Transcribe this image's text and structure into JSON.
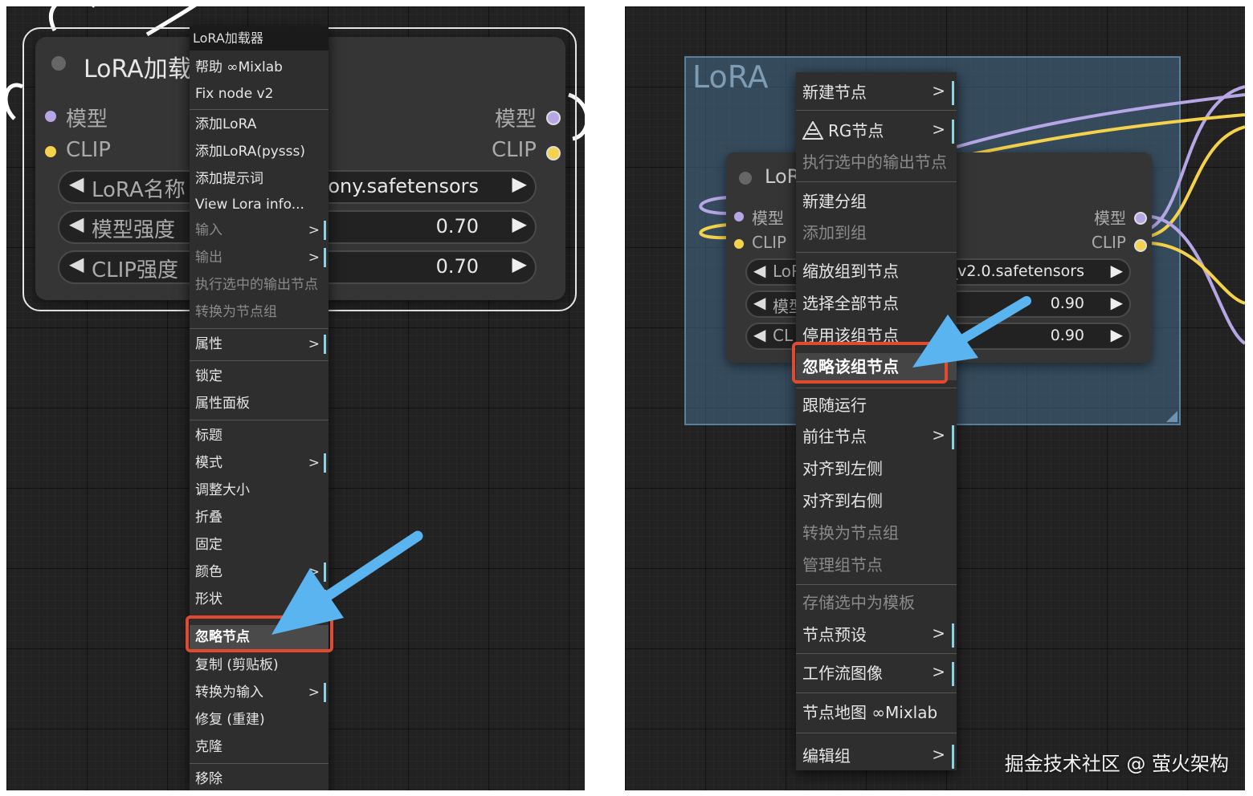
{
  "left": {
    "node": {
      "title": "LoRA加载",
      "inputs": [
        "模型",
        "CLIP"
      ],
      "outputs": [
        "模型",
        "CLIP"
      ],
      "widgets": [
        {
          "label": "LoRA名称",
          "value": "oony.safetensors"
        },
        {
          "label": "模型强度",
          "value": "0.70"
        },
        {
          "label": "CLIP强度",
          "value": "0.70"
        }
      ]
    },
    "menu": {
      "header": "LoRA加载器",
      "items": [
        {
          "label": "帮助 ∞Mixlab",
          "disabled": false,
          "submenu": false
        },
        {
          "label": "Fix node v2",
          "disabled": false,
          "submenu": false
        },
        {
          "label": "添加LoRA",
          "disabled": false,
          "submenu": false
        },
        {
          "label": "添加LoRA(pysss)",
          "disabled": false,
          "submenu": false
        },
        {
          "label": "添加提示词",
          "disabled": false,
          "submenu": false
        },
        {
          "label": "View Lora info...",
          "disabled": false,
          "submenu": false
        },
        {
          "label": "输入",
          "disabled": true,
          "submenu": true
        },
        {
          "label": "输出",
          "disabled": true,
          "submenu": true
        },
        {
          "label": "执行选中的输出节点",
          "disabled": true,
          "submenu": false
        },
        {
          "label": "转换为节点组",
          "disabled": true,
          "submenu": false
        },
        {
          "label": "属性",
          "disabled": false,
          "submenu": true
        },
        {
          "label": "锁定",
          "disabled": false,
          "submenu": false
        },
        {
          "label": "属性面板",
          "disabled": false,
          "submenu": false
        },
        {
          "label": "标题",
          "disabled": false,
          "submenu": false
        },
        {
          "label": "模式",
          "disabled": false,
          "submenu": true
        },
        {
          "label": "调整大小",
          "disabled": false,
          "submenu": false
        },
        {
          "label": "折叠",
          "disabled": false,
          "submenu": false
        },
        {
          "label": "固定",
          "disabled": false,
          "submenu": false
        },
        {
          "label": "颜色",
          "disabled": false,
          "submenu": true
        },
        {
          "label": "形状",
          "disabled": false,
          "submenu": true
        },
        {
          "label": "忽略节点",
          "disabled": false,
          "submenu": false,
          "highlighted": true
        },
        {
          "label": "复制 (剪贴板)",
          "disabled": false,
          "submenu": false
        },
        {
          "label": "转换为输入",
          "disabled": false,
          "submenu": true
        },
        {
          "label": "修复 (重建)",
          "disabled": false,
          "submenu": false
        },
        {
          "label": "克隆",
          "disabled": false,
          "submenu": false
        },
        {
          "label": "移除",
          "disabled": false,
          "submenu": false
        }
      ]
    }
  },
  "right": {
    "group": {
      "title": "LoRA"
    },
    "node": {
      "title": "LoR",
      "inputs": [
        "模型",
        "CLIP"
      ],
      "outputs": [
        "模型",
        "CLIP"
      ],
      "widgets": [
        {
          "label": "LoR",
          "value": "_v2.0.safetensors"
        },
        {
          "label": "模型",
          "value": "0.90"
        },
        {
          "label": "CL",
          "value": "0.90"
        }
      ]
    },
    "menu": {
      "items": [
        {
          "label": "新建节点",
          "disabled": false,
          "submenu": true
        },
        {
          "label": "RG节点",
          "disabled": false,
          "submenu": true,
          "icon": "rg-logo-icon"
        },
        {
          "label": "执行选中的输出节点",
          "disabled": true,
          "submenu": false
        },
        {
          "label": "新建分组",
          "disabled": false,
          "submenu": false
        },
        {
          "label": "添加到组",
          "disabled": true,
          "submenu": false
        },
        {
          "label": "缩放组到节点",
          "disabled": false,
          "submenu": false
        },
        {
          "label": "选择全部节点",
          "disabled": false,
          "submenu": false
        },
        {
          "label": "停用该组节点",
          "disabled": false,
          "submenu": false
        },
        {
          "label": "忽略该组节点",
          "disabled": false,
          "submenu": false,
          "highlighted": true
        },
        {
          "label": "跟随运行",
          "disabled": false,
          "submenu": false
        },
        {
          "label": "前往节点",
          "disabled": false,
          "submenu": true
        },
        {
          "label": "对齐到左侧",
          "disabled": false,
          "submenu": false
        },
        {
          "label": "对齐到右侧",
          "disabled": false,
          "submenu": false
        },
        {
          "label": "转换为节点组",
          "disabled": true,
          "submenu": false
        },
        {
          "label": "管理组节点",
          "disabled": true,
          "submenu": false
        },
        {
          "label": "存储选中为模板",
          "disabled": true,
          "submenu": false
        },
        {
          "label": "节点预设",
          "disabled": false,
          "submenu": true
        },
        {
          "label": "工作流图像",
          "disabled": false,
          "submenu": true
        },
        {
          "label": "节点地图 ∞Mixlab",
          "disabled": false,
          "submenu": false
        },
        {
          "label": "编辑组",
          "disabled": false,
          "submenu": true
        }
      ]
    }
  },
  "watermark": "掘金技术社区 @ 萤火架构",
  "colors": {
    "canvas": "#222222",
    "node": "#353535",
    "menu": "#2e2e2e",
    "model_port": "#b7a6e6",
    "clip_port": "#f5d24b",
    "highlight_border": "#e04a2f",
    "pointer_arrow": "#5ab4ef",
    "submenu_bar": "#8bd3e0",
    "group_fill": "#3d5a70"
  }
}
